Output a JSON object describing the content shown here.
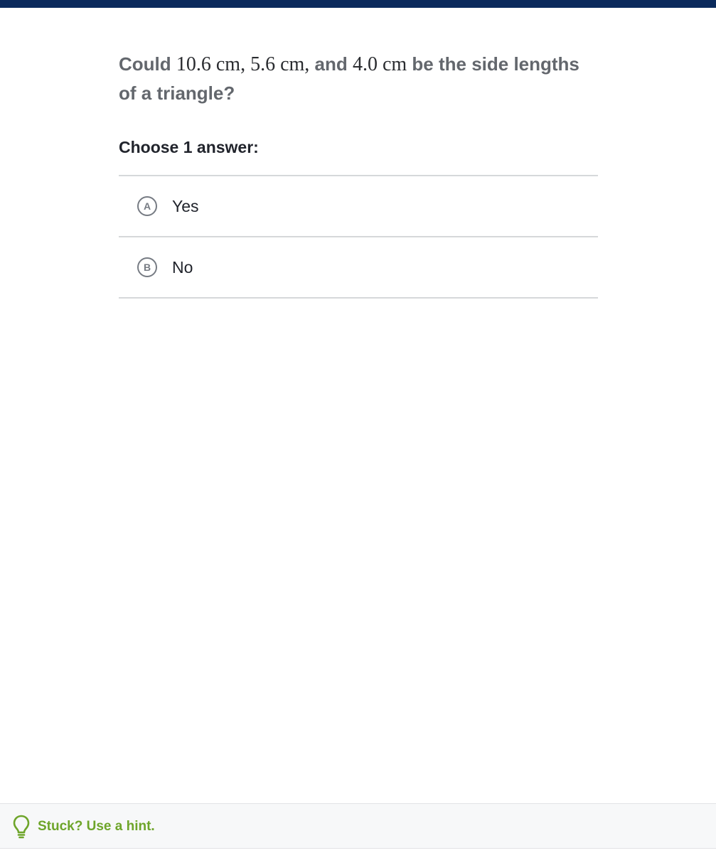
{
  "question": {
    "prefix": "Could ",
    "math_1": "10.6 cm, 5.6 cm,",
    "middle": " and ",
    "math_2": "4.0 cm",
    "suffix": " be the side lengths of a triangle?"
  },
  "choose_label": "Choose 1 answer:",
  "choices": [
    {
      "letter": "A",
      "text": "Yes"
    },
    {
      "letter": "B",
      "text": "No"
    }
  ],
  "hint": {
    "label": "Stuck? Use a hint.",
    "icon": "lightbulb-icon"
  },
  "colors": {
    "top_bar": "#0b2a5c",
    "hint_green": "#6ea52a",
    "question_gray": "#63676d"
  }
}
